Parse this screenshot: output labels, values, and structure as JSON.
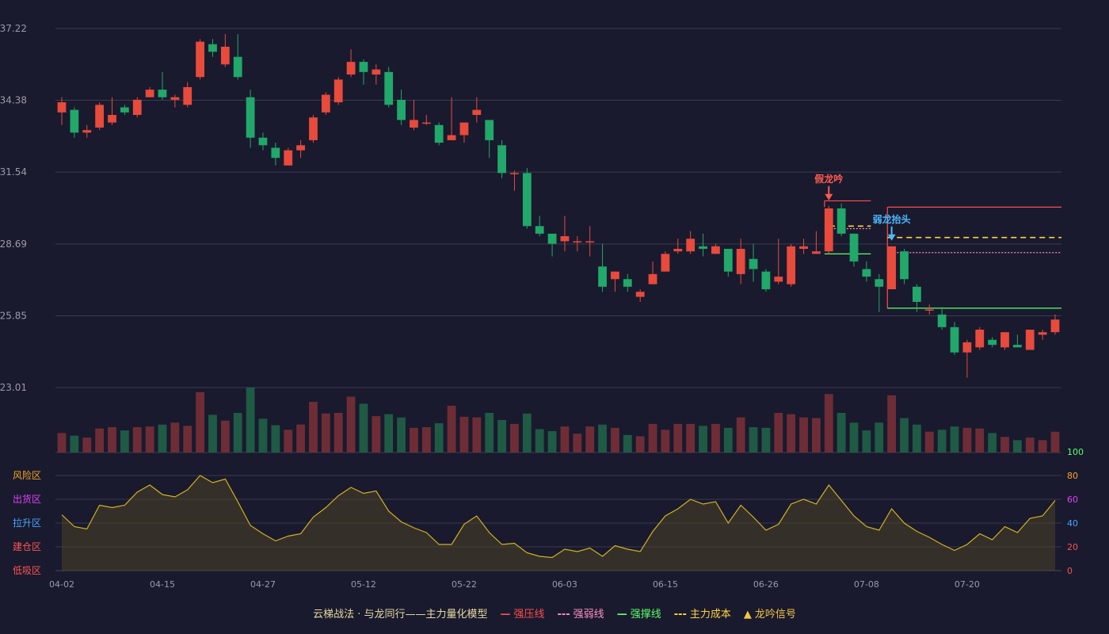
{
  "chart_data": {
    "type": "candlestick",
    "price_axis": {
      "ticks": [
        23.01,
        25.85,
        28.69,
        31.54,
        34.38,
        37.22
      ],
      "ylim": [
        23.01,
        37.22
      ],
      "grid": true
    },
    "indicator_axis": {
      "ticks": [
        0,
        20,
        40,
        60,
        80,
        100
      ],
      "ylim": [
        0,
        100
      ]
    },
    "zone_labels": [
      {
        "label": "风险区",
        "color": "#f5a623"
      },
      {
        "label": "出货区",
        "color": "#e040fb"
      },
      {
        "label": "拉升区",
        "color": "#4aa3ff"
      },
      {
        "label": "建仓区",
        "color": "#ff5252"
      },
      {
        "label": "低吸区",
        "color": "#ff5252"
      }
    ],
    "x_tick_labels": [
      "04-02",
      "04-15",
      "04-27",
      "05-12",
      "05-22",
      "06-03",
      "06-15",
      "06-26",
      "07-08",
      "07-20"
    ],
    "x_tick_index": [
      0,
      8,
      16,
      24,
      32,
      40,
      48,
      56,
      64,
      72
    ],
    "candles": [
      [
        33.9,
        34.3,
        33.4,
        34.5
      ],
      [
        34.0,
        33.1,
        32.9,
        34.1
      ],
      [
        33.1,
        33.2,
        32.9,
        33.4
      ],
      [
        33.3,
        34.2,
        33.2,
        34.3
      ],
      [
        33.5,
        33.8,
        33.4,
        34.5
      ],
      [
        34.1,
        33.9,
        33.8,
        34.2
      ],
      [
        33.8,
        34.4,
        33.7,
        34.5
      ],
      [
        34.5,
        34.8,
        34.5,
        34.9
      ],
      [
        34.8,
        34.5,
        34.4,
        35.5
      ],
      [
        34.4,
        34.5,
        34.1,
        34.6
      ],
      [
        34.2,
        34.9,
        34.1,
        35.1
      ],
      [
        35.3,
        36.7,
        35.2,
        36.8
      ],
      [
        36.6,
        36.3,
        36.1,
        36.8
      ],
      [
        35.8,
        36.5,
        35.7,
        37.0
      ],
      [
        36.1,
        35.3,
        35.2,
        37.0
      ],
      [
        34.5,
        32.9,
        32.5,
        34.8
      ],
      [
        32.9,
        32.6,
        32.4,
        33.1
      ],
      [
        32.5,
        32.1,
        31.8,
        32.7
      ],
      [
        31.8,
        32.4,
        31.8,
        32.5
      ],
      [
        32.4,
        32.6,
        32.1,
        32.8
      ],
      [
        32.8,
        33.7,
        32.7,
        33.8
      ],
      [
        33.9,
        34.6,
        33.8,
        34.7
      ],
      [
        34.3,
        35.2,
        34.2,
        35.3
      ],
      [
        35.4,
        35.9,
        35.3,
        36.4
      ],
      [
        35.9,
        35.5,
        35.0,
        36.0
      ],
      [
        35.4,
        35.6,
        35.0,
        35.8
      ],
      [
        35.5,
        34.2,
        34.1,
        35.7
      ],
      [
        34.4,
        33.6,
        33.4,
        34.8
      ],
      [
        33.3,
        33.6,
        33.2,
        34.4
      ],
      [
        33.5,
        33.5,
        33.4,
        33.8
      ],
      [
        33.4,
        32.7,
        32.6,
        33.5
      ],
      [
        32.8,
        33.0,
        32.8,
        34.5
      ],
      [
        33.0,
        33.5,
        32.7,
        33.5
      ],
      [
        33.8,
        34.0,
        33.5,
        34.5
      ],
      [
        33.6,
        32.8,
        32.1,
        33.6
      ],
      [
        32.6,
        31.5,
        31.3,
        32.8
      ],
      [
        31.5,
        31.5,
        30.8,
        31.6
      ],
      [
        31.5,
        29.4,
        29.3,
        31.7
      ],
      [
        29.4,
        29.1,
        29.0,
        29.8
      ],
      [
        29.1,
        28.7,
        28.2,
        29.1
      ],
      [
        28.8,
        29.0,
        28.4,
        29.8
      ],
      [
        28.8,
        28.8,
        28.4,
        29.0
      ],
      [
        28.8,
        28.8,
        28.2,
        29.4
      ],
      [
        27.8,
        27.0,
        26.8,
        28.7
      ],
      [
        27.3,
        27.6,
        26.8,
        27.6
      ],
      [
        27.3,
        27.0,
        26.8,
        27.5
      ],
      [
        26.6,
        26.8,
        26.4,
        26.9
      ],
      [
        27.1,
        27.5,
        27.1,
        28.0
      ],
      [
        27.6,
        28.3,
        27.6,
        28.4
      ],
      [
        28.4,
        28.5,
        28.3,
        28.9
      ],
      [
        28.4,
        28.9,
        28.3,
        29.2
      ],
      [
        28.6,
        28.5,
        28.2,
        29.1
      ],
      [
        28.3,
        28.6,
        28.3,
        28.7
      ],
      [
        28.5,
        27.6,
        27.4,
        28.5
      ],
      [
        27.5,
        28.5,
        27.1,
        28.9
      ],
      [
        28.1,
        27.7,
        27.2,
        28.7
      ],
      [
        27.6,
        26.9,
        26.8,
        27.7
      ],
      [
        27.2,
        27.4,
        27.1,
        28.9
      ],
      [
        27.1,
        28.6,
        27.0,
        28.7
      ],
      [
        28.5,
        28.6,
        28.3,
        28.9
      ],
      [
        28.3,
        28.4,
        28.3,
        29.2
      ],
      [
        28.4,
        30.1,
        28.3,
        30.2
      ],
      [
        30.1,
        29.1,
        29.0,
        30.3
      ],
      [
        29.1,
        28.0,
        27.8,
        29.1
      ],
      [
        27.7,
        27.4,
        27.2,
        28.0
      ],
      [
        27.3,
        27.0,
        26.0,
        27.5
      ],
      [
        26.9,
        28.6,
        26.9,
        28.6
      ],
      [
        28.4,
        27.3,
        27.1,
        28.5
      ],
      [
        27.0,
        26.4,
        26.0,
        27.1
      ],
      [
        26.1,
        26.1,
        25.9,
        26.3
      ],
      [
        25.9,
        25.4,
        25.3,
        26.2
      ],
      [
        25.4,
        24.4,
        24.3,
        25.6
      ],
      [
        24.4,
        24.8,
        23.4,
        24.9
      ],
      [
        24.6,
        25.3,
        24.5,
        25.4
      ],
      [
        24.9,
        24.7,
        24.6,
        25.0
      ],
      [
        24.6,
        25.2,
        24.5,
        25.2
      ],
      [
        24.7,
        24.6,
        24.6,
        25.1
      ],
      [
        24.5,
        25.3,
        24.5,
        25.3
      ],
      [
        25.1,
        25.2,
        24.9,
        25.3
      ],
      [
        25.2,
        25.7,
        25.1,
        25.9
      ]
    ],
    "volume": [
      30,
      26,
      23,
      37,
      39,
      34,
      39,
      40,
      43,
      46,
      41,
      93,
      58,
      49,
      61,
      100,
      52,
      42,
      35,
      43,
      78,
      60,
      61,
      86,
      75,
      56,
      59,
      54,
      38,
      39,
      45,
      72,
      55,
      54,
      61,
      50,
      44,
      60,
      36,
      33,
      40,
      29,
      40,
      43,
      38,
      27,
      25,
      44,
      35,
      44,
      44,
      41,
      44,
      38,
      54,
      39,
      38,
      61,
      59,
      54,
      53,
      90,
      61,
      46,
      34,
      46,
      88,
      53,
      43,
      32,
      35,
      40,
      38,
      37,
      30,
      24,
      19,
      23,
      19,
      32
    ],
    "indicator_series": [
      47,
      37,
      35,
      55,
      53,
      55,
      66,
      72,
      64,
      62,
      68,
      80,
      74,
      77,
      58,
      38,
      31,
      25,
      29,
      31,
      45,
      53,
      63,
      70,
      65,
      67,
      50,
      41,
      36,
      32,
      22,
      22,
      39,
      46,
      32,
      22,
      23,
      15,
      12,
      11,
      18,
      16,
      19,
      12,
      21,
      18,
      16,
      33,
      46,
      52,
      60,
      56,
      58,
      40,
      55,
      45,
      34,
      39,
      56,
      60,
      56,
      72,
      59,
      46,
      37,
      34,
      52,
      40,
      33,
      28,
      22,
      17,
      22,
      31,
      26,
      37,
      32,
      44,
      46,
      59
    ],
    "colors": {
      "up": "#e84a3c",
      "down": "#21a86a",
      "indicator": "#d4b020",
      "background": "#191a2e",
      "grid": "#3a3b4d"
    },
    "annotations": [
      {
        "label": "假龙吟",
        "index": 61,
        "color": "#ff5a4f",
        "arrow": "down"
      },
      {
        "label": "弱龙抬头",
        "index": 66,
        "color": "#4fb8ff",
        "arrow": "down"
      }
    ],
    "level_boxes": [
      {
        "start": 61,
        "end": 64,
        "strong_pressure": 30.4,
        "weak_line": 29.3,
        "support": 28.3,
        "cost_line": 29.4,
        "closed": false
      },
      {
        "start": 66,
        "end": 79,
        "strong_pressure": 30.15,
        "weak_line": 28.35,
        "support": 26.15,
        "cost_line": 28.95,
        "closed": true
      }
    ],
    "legend": [
      {
        "label": "云梯战法 · 与龙同行——主力量化模型",
        "color": "#e8d9a0",
        "symbol": ""
      },
      {
        "label": "强压线",
        "color": "#ff4d4d",
        "symbol": "—"
      },
      {
        "label": "强弱线",
        "color": "#ff8fc0",
        "symbol": "---"
      },
      {
        "label": "强撑线",
        "color": "#5cff6a",
        "symbol": "—"
      },
      {
        "label": "主力成本",
        "color": "#ffd23f",
        "symbol": "---"
      },
      {
        "label": "龙吟信号",
        "color": "#f5c542",
        "symbol": "▲"
      }
    ]
  }
}
